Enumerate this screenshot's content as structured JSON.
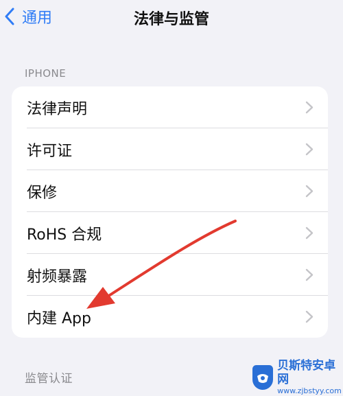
{
  "nav": {
    "back_label": "通用",
    "title": "法律与监管"
  },
  "sections": {
    "iphone_header": "IPHONE",
    "regulatory_header": "监管认证"
  },
  "list_items": [
    {
      "label": "法律声明"
    },
    {
      "label": "许可证"
    },
    {
      "label": "保修"
    },
    {
      "label": "RoHS 合规"
    },
    {
      "label": "射频暴露"
    },
    {
      "label": "内建 App"
    }
  ],
  "watermark": {
    "title": "贝斯特安卓网",
    "url": "www.zjbstyy.com"
  },
  "colors": {
    "accent": "#2f7cf6",
    "background": "#f2f2f7",
    "annotation_arrow": "#e23a2f",
    "watermark": "#2a6fd6"
  }
}
